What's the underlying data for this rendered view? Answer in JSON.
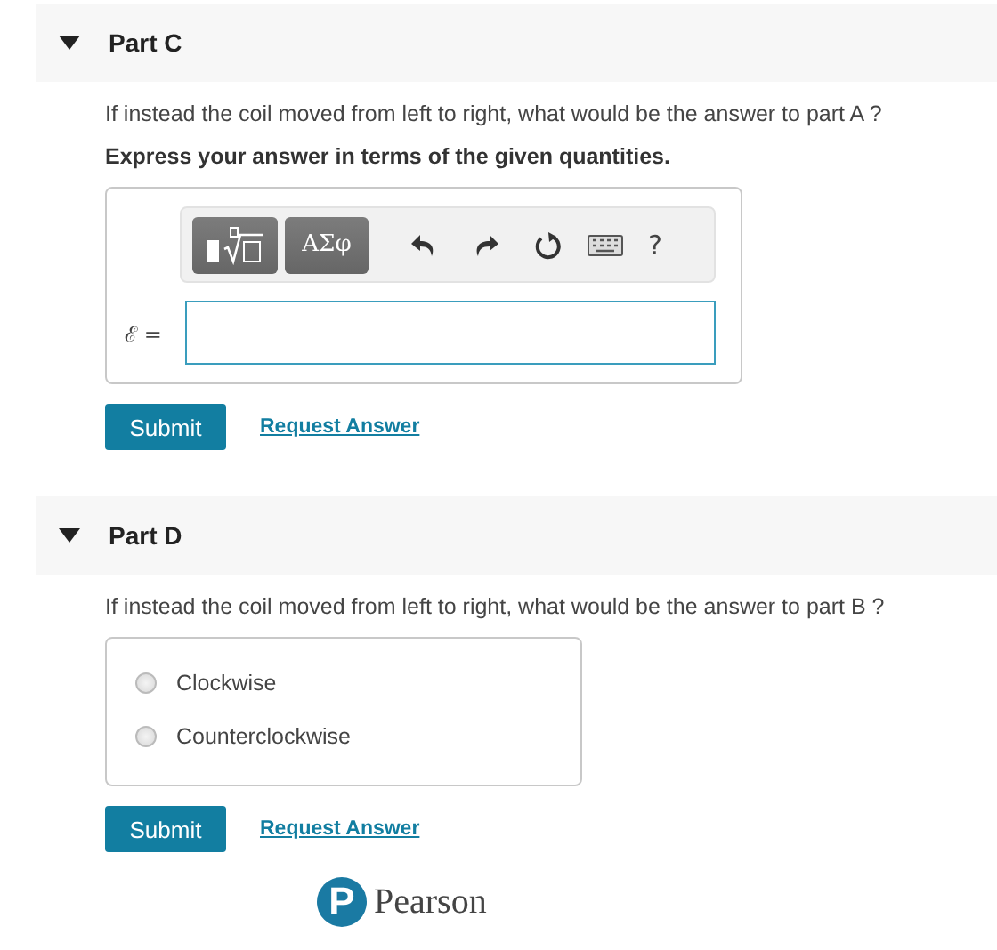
{
  "parts": [
    {
      "title": "Part C",
      "expanded": true,
      "kind": "formula",
      "question": "If instead the coil moved from left to right, what would be the answer to part A ?",
      "instruction": "Express your answer in terms of the given quantities.",
      "toolbar": {
        "symbols_button": "ΑΣφ",
        "help": "?"
      },
      "variable": "ℰ =",
      "submit": "Submit",
      "request": "Request Answer"
    },
    {
      "title": "Part D",
      "expanded": true,
      "kind": "choice",
      "question": "If instead the coil moved from left to right, what would be the answer to part B ?",
      "options": [
        {
          "label": "Clockwise",
          "selected": false
        },
        {
          "label": "Counterclockwise",
          "selected": false
        }
      ],
      "submit": "Submit",
      "request": "Request Answer"
    }
  ],
  "logo": {
    "mark": "P",
    "name": "Pearson"
  }
}
